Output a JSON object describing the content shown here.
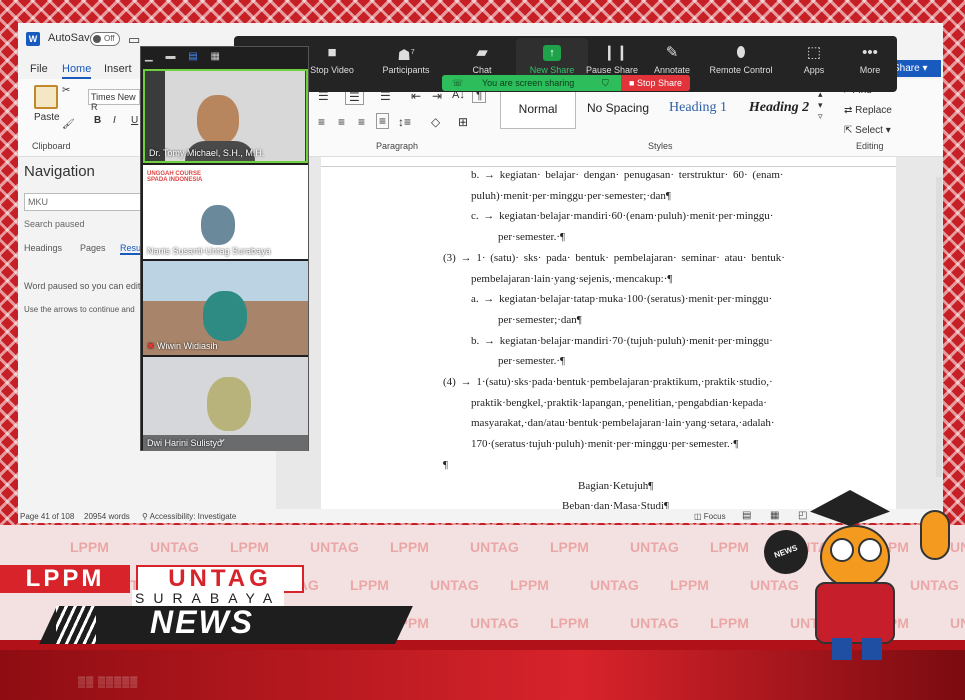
{
  "word": {
    "autosave_label": "AutoSave",
    "autosave_state": "Off",
    "menus": [
      "File",
      "Home",
      "Insert"
    ],
    "active_menu": "Home",
    "share_label": "Share",
    "font_name": "Times New R",
    "paste_label": "Paste",
    "group_labels": {
      "clipboard": "Clipboard",
      "paragraph": "Paragraph",
      "styles": "Styles",
      "editing": "Editing"
    },
    "styles": [
      "Normal",
      "No Spacing",
      "Heading 1",
      "Heading 2"
    ],
    "editing": {
      "find": "Find",
      "replace": "Replace",
      "select": "Select"
    },
    "navigation": {
      "title": "Navigation",
      "search_value": "MKU",
      "search_status": "Search paused",
      "tabs": [
        "Headings",
        "Pages",
        "Resu"
      ],
      "message1": "Word paused so you can edit y",
      "message2": "Use the arrows to continue and"
    },
    "document_lines": [
      "b. → kegiatan· belajar· dengan· penugasan· terstruktur· 60· (enam·",
      "puluh)·menit·per·minggu·per·semester;·dan¶",
      "c. → kegiatan·belajar·mandiri·60·(enam·puluh)·menit·per·minggu·",
      "per·semester.·¶",
      "(3) → 1· (satu)· sks· pada· bentuk· pembelajaran· seminar· atau· bentuk·",
      "pembelajaran·lain·yang·sejenis,·mencakup:·¶",
      "a. → kegiatan·belajar·tatap·muka·100·(seratus)·menit·per·minggu·",
      "per·semester;·dan¶",
      "b. → kegiatan·belajar·mandiri·70·(tujuh·puluh)·menit·per·minggu·",
      "per·semester.·¶",
      "(4) → 1·(satu)·sks·pada·bentuk·pembelajaran·praktikum,·praktik·studio,·",
      "praktik·bengkel,·praktik·lapangan,·penelitian,·pengabdian·kepada·",
      "masyarakat,·dan/atau·bentuk·pembelajaran·lain·yang·setara,·adalah·",
      "170·(seratus·tujuh·puluh)·menit·per·minggu·per·semester.·¶",
      "¶",
      "Bagian·Ketujuh¶",
      "Beban·dan·Masa·Studi¶"
    ],
    "status": {
      "page": "Page 41 of 108",
      "words": "20954 words",
      "accessibility": "Accessibility: Investigate",
      "focus": "Focus"
    }
  },
  "zoom": {
    "buttons": [
      "Stop Video",
      "Participants",
      "Chat",
      "New Share",
      "Pause Share",
      "Annotate",
      "Remote Control",
      "Apps",
      "More"
    ],
    "participants_count": "7",
    "sharing_message": "You are screen sharing",
    "stop_share": "Stop Share"
  },
  "gallery": {
    "participants": [
      "Dr. Tomy Michael, S.H., M.H.",
      "Nanis Susanti-Untag Surabaya",
      "Wiwin Widiasih",
      "Dwi Harini Sulistyo"
    ],
    "slide_text": "UNGGAH COURSE SPADA INDONESIA"
  },
  "banner": {
    "brand": "LPPM",
    "brand2": "UNTAG",
    "city": "SURABAYA",
    "news": "NEWS",
    "mic_label": "NEWS"
  },
  "colors": {
    "brand_red": "#c62026",
    "word_blue": "#185abd",
    "zoom_green": "#2dbd5a"
  }
}
